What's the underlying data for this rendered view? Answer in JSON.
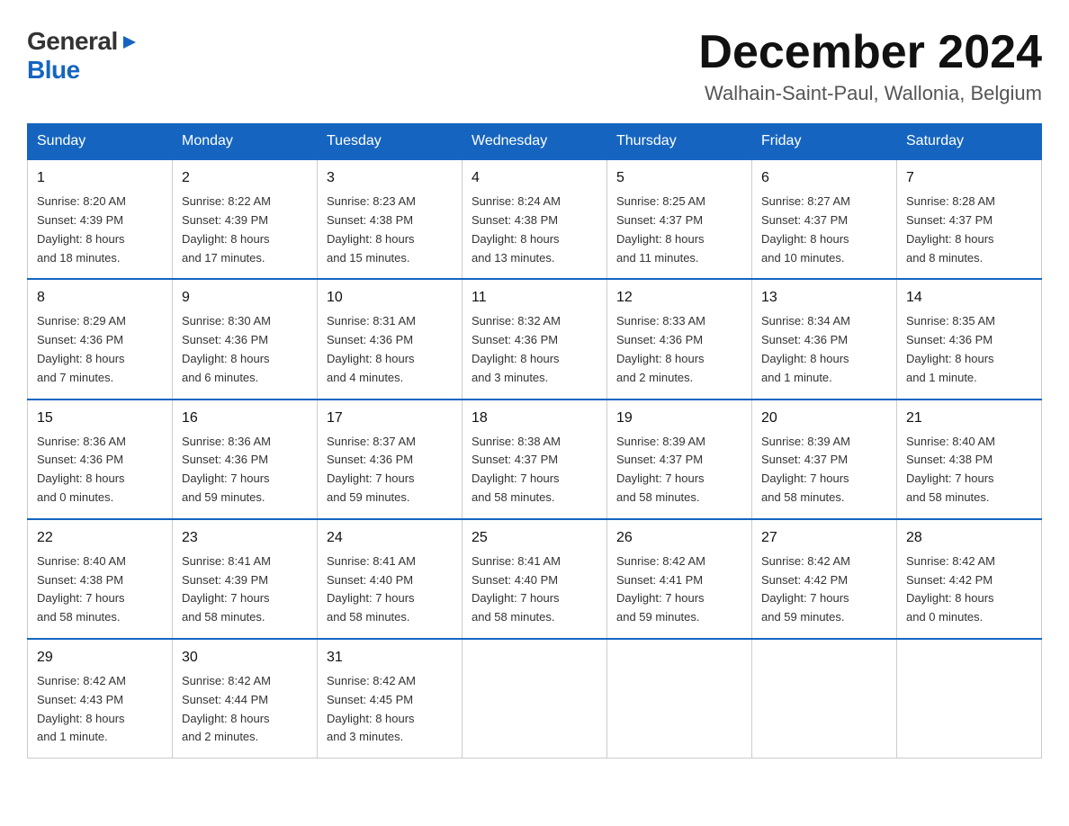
{
  "logo": {
    "text_general": "General",
    "text_blue": "Blue",
    "arrow": "▶"
  },
  "header": {
    "month_title": "December 2024",
    "location": "Walhain-Saint-Paul, Wallonia, Belgium"
  },
  "weekdays": [
    "Sunday",
    "Monday",
    "Tuesday",
    "Wednesday",
    "Thursday",
    "Friday",
    "Saturday"
  ],
  "weeks": [
    [
      {
        "day": "1",
        "info": "Sunrise: 8:20 AM\nSunset: 4:39 PM\nDaylight: 8 hours\nand 18 minutes."
      },
      {
        "day": "2",
        "info": "Sunrise: 8:22 AM\nSunset: 4:39 PM\nDaylight: 8 hours\nand 17 minutes."
      },
      {
        "day": "3",
        "info": "Sunrise: 8:23 AM\nSunset: 4:38 PM\nDaylight: 8 hours\nand 15 minutes."
      },
      {
        "day": "4",
        "info": "Sunrise: 8:24 AM\nSunset: 4:38 PM\nDaylight: 8 hours\nand 13 minutes."
      },
      {
        "day": "5",
        "info": "Sunrise: 8:25 AM\nSunset: 4:37 PM\nDaylight: 8 hours\nand 11 minutes."
      },
      {
        "day": "6",
        "info": "Sunrise: 8:27 AM\nSunset: 4:37 PM\nDaylight: 8 hours\nand 10 minutes."
      },
      {
        "day": "7",
        "info": "Sunrise: 8:28 AM\nSunset: 4:37 PM\nDaylight: 8 hours\nand 8 minutes."
      }
    ],
    [
      {
        "day": "8",
        "info": "Sunrise: 8:29 AM\nSunset: 4:36 PM\nDaylight: 8 hours\nand 7 minutes."
      },
      {
        "day": "9",
        "info": "Sunrise: 8:30 AM\nSunset: 4:36 PM\nDaylight: 8 hours\nand 6 minutes."
      },
      {
        "day": "10",
        "info": "Sunrise: 8:31 AM\nSunset: 4:36 PM\nDaylight: 8 hours\nand 4 minutes."
      },
      {
        "day": "11",
        "info": "Sunrise: 8:32 AM\nSunset: 4:36 PM\nDaylight: 8 hours\nand 3 minutes."
      },
      {
        "day": "12",
        "info": "Sunrise: 8:33 AM\nSunset: 4:36 PM\nDaylight: 8 hours\nand 2 minutes."
      },
      {
        "day": "13",
        "info": "Sunrise: 8:34 AM\nSunset: 4:36 PM\nDaylight: 8 hours\nand 1 minute."
      },
      {
        "day": "14",
        "info": "Sunrise: 8:35 AM\nSunset: 4:36 PM\nDaylight: 8 hours\nand 1 minute."
      }
    ],
    [
      {
        "day": "15",
        "info": "Sunrise: 8:36 AM\nSunset: 4:36 PM\nDaylight: 8 hours\nand 0 minutes."
      },
      {
        "day": "16",
        "info": "Sunrise: 8:36 AM\nSunset: 4:36 PM\nDaylight: 7 hours\nand 59 minutes."
      },
      {
        "day": "17",
        "info": "Sunrise: 8:37 AM\nSunset: 4:36 PM\nDaylight: 7 hours\nand 59 minutes."
      },
      {
        "day": "18",
        "info": "Sunrise: 8:38 AM\nSunset: 4:37 PM\nDaylight: 7 hours\nand 58 minutes."
      },
      {
        "day": "19",
        "info": "Sunrise: 8:39 AM\nSunset: 4:37 PM\nDaylight: 7 hours\nand 58 minutes."
      },
      {
        "day": "20",
        "info": "Sunrise: 8:39 AM\nSunset: 4:37 PM\nDaylight: 7 hours\nand 58 minutes."
      },
      {
        "day": "21",
        "info": "Sunrise: 8:40 AM\nSunset: 4:38 PM\nDaylight: 7 hours\nand 58 minutes."
      }
    ],
    [
      {
        "day": "22",
        "info": "Sunrise: 8:40 AM\nSunset: 4:38 PM\nDaylight: 7 hours\nand 58 minutes."
      },
      {
        "day": "23",
        "info": "Sunrise: 8:41 AM\nSunset: 4:39 PM\nDaylight: 7 hours\nand 58 minutes."
      },
      {
        "day": "24",
        "info": "Sunrise: 8:41 AM\nSunset: 4:40 PM\nDaylight: 7 hours\nand 58 minutes."
      },
      {
        "day": "25",
        "info": "Sunrise: 8:41 AM\nSunset: 4:40 PM\nDaylight: 7 hours\nand 58 minutes."
      },
      {
        "day": "26",
        "info": "Sunrise: 8:42 AM\nSunset: 4:41 PM\nDaylight: 7 hours\nand 59 minutes."
      },
      {
        "day": "27",
        "info": "Sunrise: 8:42 AM\nSunset: 4:42 PM\nDaylight: 7 hours\nand 59 minutes."
      },
      {
        "day": "28",
        "info": "Sunrise: 8:42 AM\nSunset: 4:42 PM\nDaylight: 8 hours\nand 0 minutes."
      }
    ],
    [
      {
        "day": "29",
        "info": "Sunrise: 8:42 AM\nSunset: 4:43 PM\nDaylight: 8 hours\nand 1 minute."
      },
      {
        "day": "30",
        "info": "Sunrise: 8:42 AM\nSunset: 4:44 PM\nDaylight: 8 hours\nand 2 minutes."
      },
      {
        "day": "31",
        "info": "Sunrise: 8:42 AM\nSunset: 4:45 PM\nDaylight: 8 hours\nand 3 minutes."
      },
      null,
      null,
      null,
      null
    ]
  ]
}
